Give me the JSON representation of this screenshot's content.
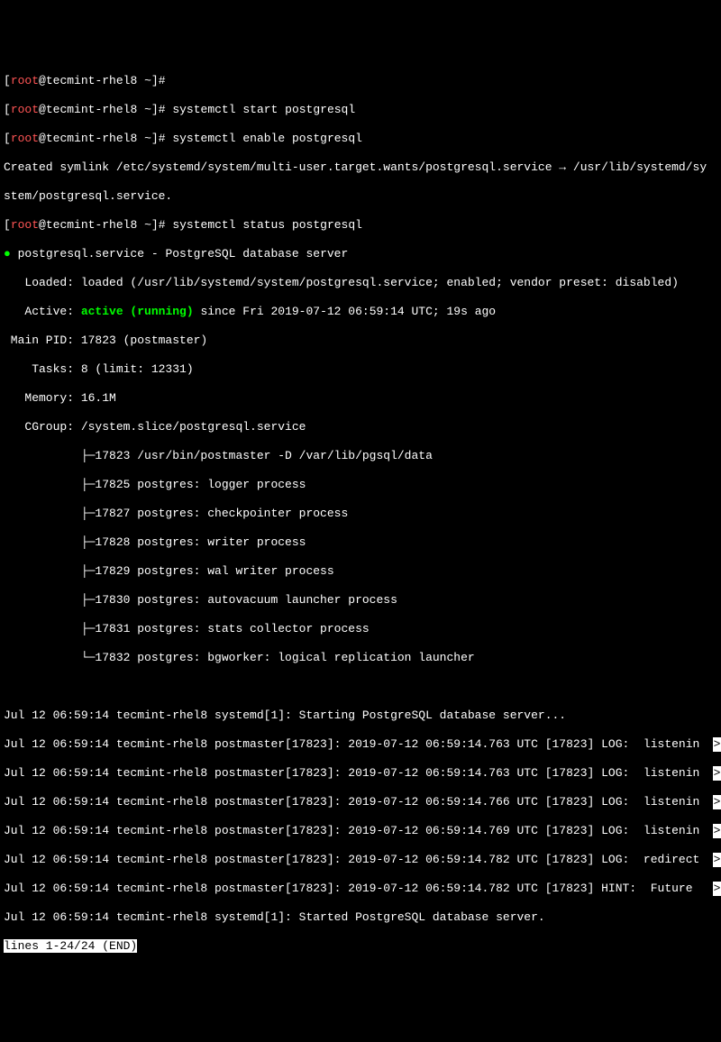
{
  "prompt": {
    "user": "root",
    "host": "tecmint-rhel8",
    "cwd": "~",
    "symbol": "#"
  },
  "commands": {
    "cmd0": "",
    "cmd1": "systemctl start postgresql",
    "cmd2": "systemctl enable postgresql",
    "cmd3": "systemctl status postgresql"
  },
  "symlink_output": {
    "line1": "Created symlink /etc/systemd/system/multi-user.target.wants/postgresql.service → /usr/lib/systemd/sy",
    "line2": "stem/postgresql.service."
  },
  "status": {
    "dot": "●",
    "service_line": " postgresql.service - PostgreSQL database server",
    "loaded": "   Loaded: loaded (/usr/lib/systemd/system/postgresql.service; enabled; vendor preset: disabled)",
    "active_prefix": "   Active: ",
    "active_status": "active (running)",
    "active_suffix": " since Fri 2019-07-12 06:59:14 UTC; 19s ago",
    "main_pid": " Main PID: 17823 (postmaster)",
    "tasks": "    Tasks: 8 (limit: 12331)",
    "memory": "   Memory: 16.1M",
    "cgroup": "   CGroup: /system.slice/postgresql.service",
    "proc1": "           ├─17823 /usr/bin/postmaster -D /var/lib/pgsql/data",
    "proc2": "           ├─17825 postgres: logger process   ",
    "proc3": "           ├─17827 postgres: checkpointer process   ",
    "proc4": "           ├─17828 postgres: writer process   ",
    "proc5": "           ├─17829 postgres: wal writer process   ",
    "proc6": "           ├─17830 postgres: autovacuum launcher process   ",
    "proc7": "           ├─17831 postgres: stats collector process   ",
    "proc8": "           └─17832 postgres: bgworker: logical replication launcher   "
  },
  "logs": {
    "l1": "Jul 12 06:59:14 tecmint-rhel8 systemd[1]: Starting PostgreSQL database server...",
    "l2": "Jul 12 06:59:14 tecmint-rhel8 postmaster[17823]: 2019-07-12 06:59:14.763 UTC [17823] LOG:  listenin",
    "l3": "Jul 12 06:59:14 tecmint-rhel8 postmaster[17823]: 2019-07-12 06:59:14.763 UTC [17823] LOG:  listenin",
    "l4": "Jul 12 06:59:14 tecmint-rhel8 postmaster[17823]: 2019-07-12 06:59:14.766 UTC [17823] LOG:  listenin",
    "l5": "Jul 12 06:59:14 tecmint-rhel8 postmaster[17823]: 2019-07-12 06:59:14.769 UTC [17823] LOG:  listenin",
    "l6": "Jul 12 06:59:14 tecmint-rhel8 postmaster[17823]: 2019-07-12 06:59:14.782 UTC [17823] LOG:  redirect",
    "l7": "Jul 12 06:59:14 tecmint-rhel8 postmaster[17823]: 2019-07-12 06:59:14.782 UTC [17823] HINT:  Future ",
    "l8": "Jul 12 06:59:14 tecmint-rhel8 systemd[1]: Started PostgreSQL database server."
  },
  "pager": {
    "status": "lines 1-24/24 (END)",
    "arrow": ">"
  }
}
